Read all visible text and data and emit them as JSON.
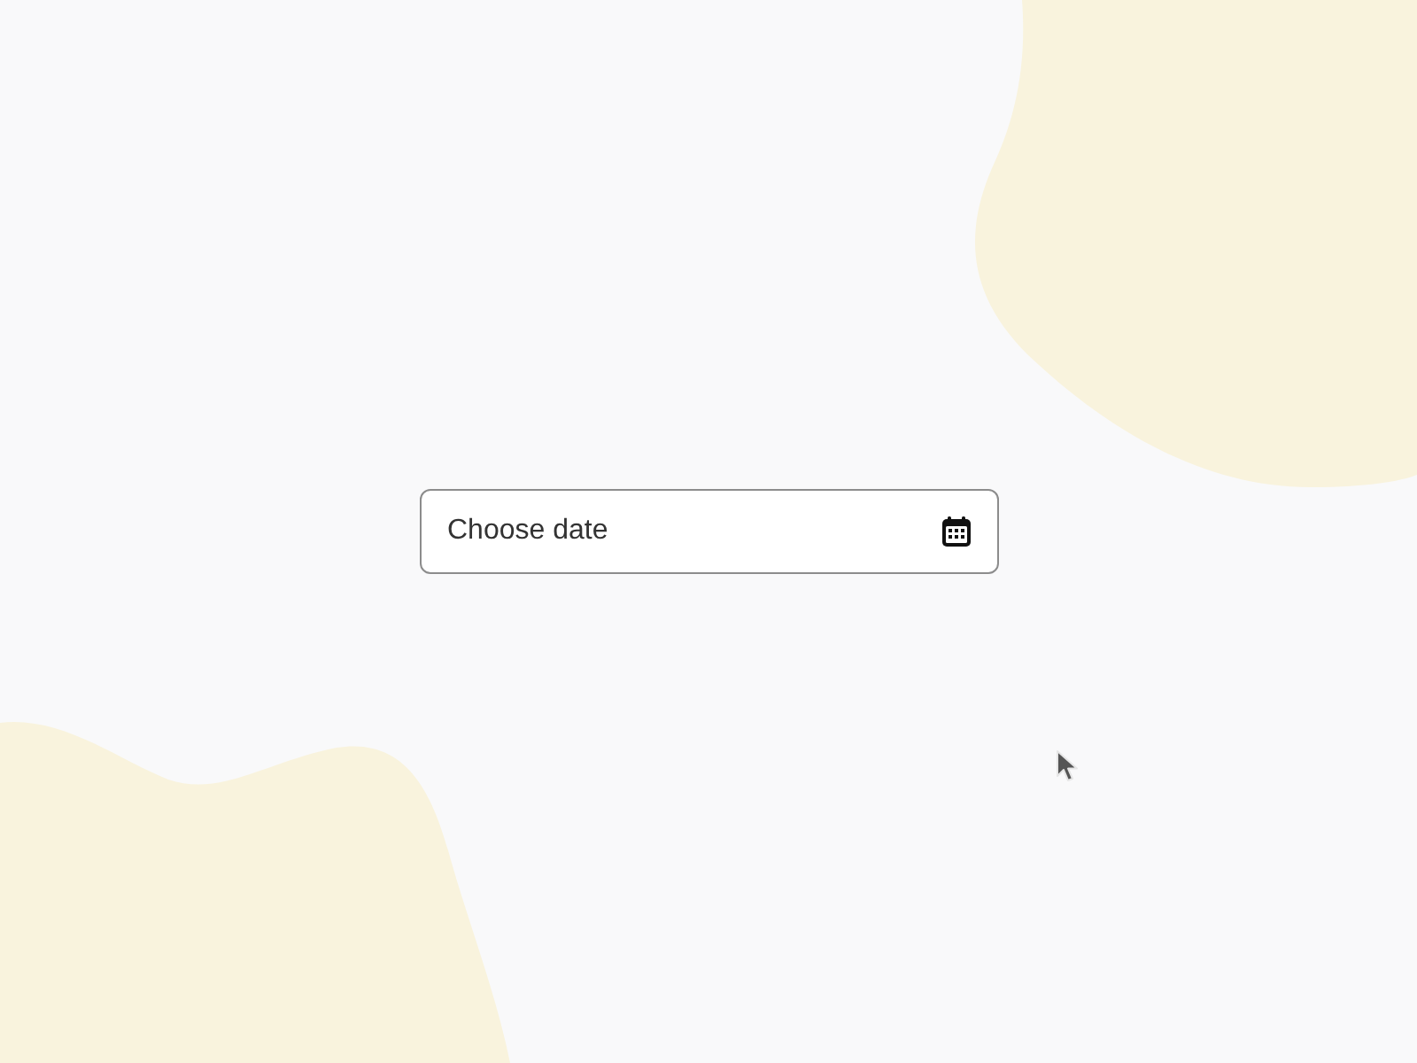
{
  "date_field": {
    "placeholder": "Choose date"
  }
}
